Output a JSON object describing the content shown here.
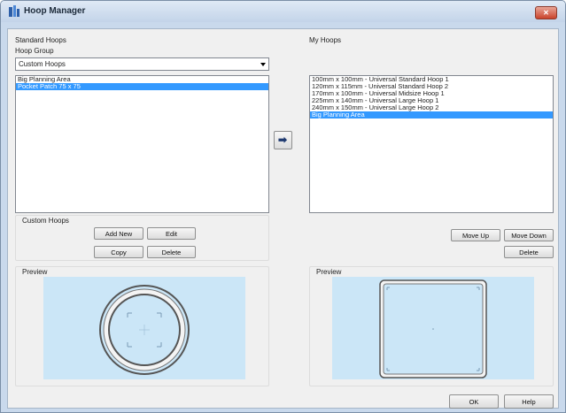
{
  "window": {
    "title": "Hoop Manager",
    "close_label": "✕"
  },
  "standard": {
    "section_label": "Standard Hoops",
    "group_label": "Hoop Group",
    "group_value": "Custom Hoops",
    "list": [
      "Big Planning Area",
      "Pocket Patch 75 x 75"
    ],
    "selected_index": 1,
    "custom_label": "Custom Hoops",
    "buttons": {
      "add_new": "Add New",
      "edit": "Edit",
      "copy": "Copy",
      "delete": "Delete"
    },
    "preview_label": "Preview"
  },
  "transfer_icon": "arrow-right-icon",
  "my": {
    "section_label": "My Hoops",
    "list": [
      "100mm x 100mm - Universal Standard Hoop 1",
      "120mm x 115mm - Universal Standard Hoop 2",
      "170mm x 100mm - Universal Midsize Hoop 1",
      "225mm x 140mm - Universal Large Hoop 1",
      "240mm x 150mm - Universal Large Hoop 2",
      "Big Planning Area"
    ],
    "selected_index": 5,
    "buttons": {
      "move_up": "Move Up",
      "move_down": "Move Down",
      "delete": "Delete"
    },
    "preview_label": "Preview"
  },
  "footer": {
    "ok": "OK",
    "help": "Help"
  },
  "colors": {
    "selection": "#3399ff",
    "preview_bg": "#cbe6f7"
  }
}
